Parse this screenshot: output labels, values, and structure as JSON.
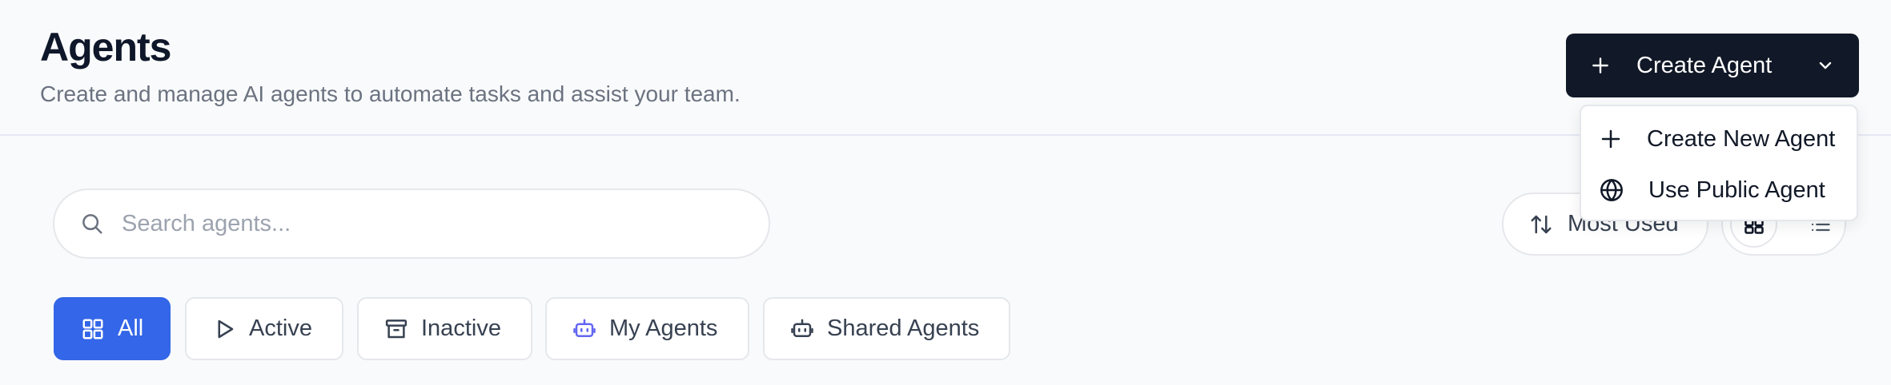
{
  "header": {
    "title": "Agents",
    "subtitle": "Create and manage AI agents to automate tasks and assist your team."
  },
  "create_button": {
    "label": "Create Agent",
    "icon": "plus-icon",
    "dropdown_icon": "chevron-down-icon"
  },
  "create_menu": {
    "items": [
      {
        "label": "Create New Agent",
        "icon": "plus-icon"
      },
      {
        "label": "Use Public Agent",
        "icon": "globe-icon"
      }
    ]
  },
  "search": {
    "placeholder": "Search agents...",
    "value": ""
  },
  "sort": {
    "label": "Most Used",
    "icon": "sort-arrows-icon"
  },
  "view_toggle": {
    "selected": "grid",
    "options": [
      "grid",
      "list"
    ]
  },
  "tabs": [
    {
      "label": "All",
      "icon": "grid-icon",
      "active": true
    },
    {
      "label": "Active",
      "icon": "play-icon",
      "active": false
    },
    {
      "label": "Inactive",
      "icon": "archive-icon",
      "active": false
    },
    {
      "label": "My Agents",
      "icon": "bot-icon",
      "active": false
    },
    {
      "label": "Shared Agents",
      "icon": "bot-icon",
      "active": false
    }
  ],
  "colors": {
    "primary_dark": "#111827",
    "accent_blue": "#3366e8",
    "bot_icon_purple": "#6366f1",
    "border": "#e5e7eb",
    "muted_text": "#6b7280"
  }
}
